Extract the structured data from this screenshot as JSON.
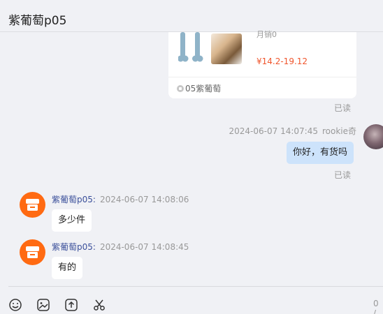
{
  "header": {
    "title": "紫葡萄p05"
  },
  "product_card": {
    "sales_text": "月销0",
    "price": "¥14.2-19.12",
    "shop_name": "05紫葡萄"
  },
  "read_receipt": "已读",
  "messages": [
    {
      "from": "me",
      "time": "2024-06-07 14:07:45",
      "sender": "rookie奇",
      "text": "你好，有货吗",
      "status": "已读"
    },
    {
      "from": "them",
      "sender": "紫葡萄p05:",
      "time": "2024-06-07 14:08:06",
      "text": "多少件"
    },
    {
      "from": "them",
      "sender": "紫葡萄p05:",
      "time": "2024-06-07 14:08:45",
      "text": "有的"
    }
  ],
  "composer": {
    "icons": [
      "emoji-icon",
      "image-icon",
      "upload-icon",
      "scissors-icon"
    ],
    "counter": "0 /"
  },
  "colors": {
    "price": "#f0562d",
    "my_bubble": "#cde3fb",
    "shop_avatar": "#ff6a12",
    "sender_name": "#3a4f9a"
  }
}
